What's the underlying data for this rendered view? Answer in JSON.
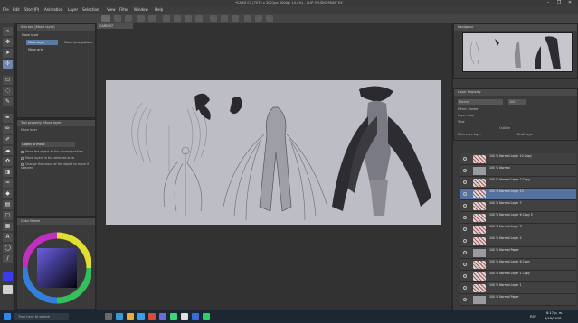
{
  "window": {
    "title": "*CARD 07 (7075 x 3022px 600dpi 14.4%) - CLIP STUDIO PAINT EX",
    "controls": [
      "–",
      "❐",
      "✕"
    ]
  },
  "menu": [
    "File",
    "Edit",
    "Story(P)",
    "Animation",
    "Layer",
    "Selection",
    "View",
    "Filter",
    "Window",
    "Help"
  ],
  "subtool_panel": {
    "tabs": [
      "Sub tool [Move layer]"
    ],
    "items": [
      "Move layer",
      "Move layer",
      "Move tone pattern",
      "Move grid"
    ],
    "selected": 1
  },
  "tool_property": {
    "title": "Tool property [Move layer]",
    "subtitle": "Move layer",
    "object_label": "Object to move",
    "options": [
      "Move the object at the clicked position",
      "Move layers in the selected area",
      "Change the colour of the object to move if selected"
    ]
  },
  "color_panel": {
    "title": "Color Wheel"
  },
  "document": {
    "tab": "CARD 07"
  },
  "navigator": {
    "title": "Navigator"
  },
  "layer_property": {
    "title": "Layer Property",
    "mode_label": "Normal",
    "opacity": "100",
    "options": [
      "Effect: Border",
      "Layer color",
      "Tone",
      "Outline",
      "Reference layer",
      "Draft layer"
    ]
  },
  "layers": [
    {
      "name": "100 % Normal\nLayer 10 Copy",
      "pattern": true
    },
    {
      "name": "100 % Normal",
      "pattern": false
    },
    {
      "name": "100 % Normal\nLayer 7 Copy",
      "pattern": true
    },
    {
      "name": "100 % Normal\nLayer 10",
      "pattern": true
    },
    {
      "name": "100 % Normal\nLayer 7",
      "pattern": true
    },
    {
      "name": "100 % Normal\nLayer 6 Copy 2",
      "pattern": true
    },
    {
      "name": "100 % Normal\nLayer 3",
      "pattern": true
    },
    {
      "name": "100 % Normal\nLayer 2",
      "pattern": true
    },
    {
      "name": "100 % Normal\nPaper",
      "pattern": false
    },
    {
      "name": "100 % Normal\nLayer 6 Copy",
      "pattern": true
    },
    {
      "name": "100 % Normal\nLayer 1 Copy",
      "pattern": true
    },
    {
      "name": "100 % Normal\nLayer 1",
      "pattern": true
    },
    {
      "name": "100 % Normal\nPaper",
      "pattern": false
    }
  ],
  "taskbar": {
    "search_placeholder": "Type here to search",
    "time": "8:17 p. m.",
    "date": "6/18/2018",
    "lang": "ESP"
  },
  "colors": {
    "accent": "#5672a0",
    "canvas": "#bdbdc5",
    "dark": "#3a3a3a"
  }
}
